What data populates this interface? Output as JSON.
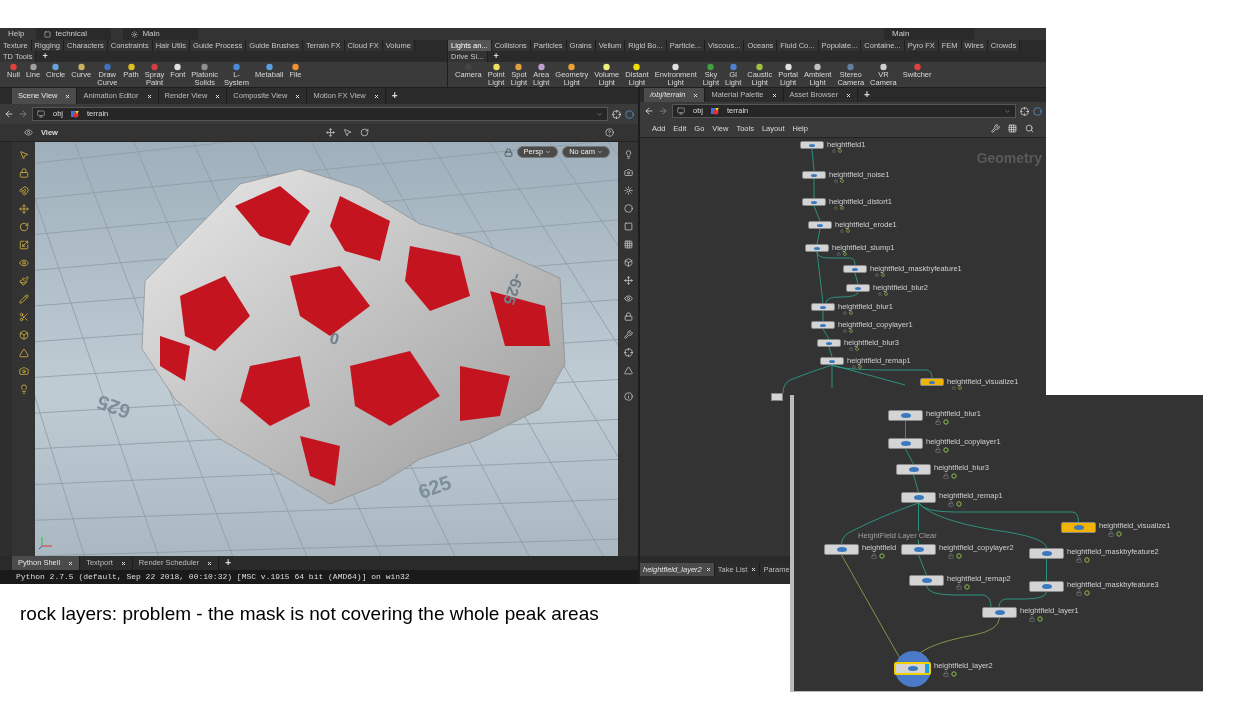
{
  "top_bar": {
    "menu": "Help",
    "desktops": [
      "technical",
      "Main"
    ],
    "right_desktop": "Main"
  },
  "shelf_left": {
    "tabs": [
      {
        "label": "Texture",
        "selected": false
      },
      {
        "label": "Rigging",
        "selected": false
      },
      {
        "label": "Characters",
        "selected": false
      },
      {
        "label": "Constraints",
        "selected": false
      },
      {
        "label": "Hair Utils",
        "selected": false
      },
      {
        "label": "Guide Process",
        "selected": false
      },
      {
        "label": "Guide Brushes",
        "selected": false
      },
      {
        "label": "Terrain FX",
        "selected": false
      },
      {
        "label": "Cloud FX",
        "selected": false
      },
      {
        "label": "Volume",
        "selected": false
      },
      {
        "label": "TD Tools",
        "selected": false
      }
    ],
    "add": "+",
    "tools": [
      "Null",
      "Line",
      "Circle",
      "Curve",
      "Draw Curve",
      "Path",
      "Spray Paint",
      "Font",
      "Platonic Solids",
      "L-System",
      "Metaball",
      "File"
    ]
  },
  "shelf_right": {
    "tabs": [
      {
        "label": "Lights an...",
        "selected": true
      },
      {
        "label": "Collisions",
        "selected": false
      },
      {
        "label": "Particles",
        "selected": false
      },
      {
        "label": "Grains",
        "selected": false
      },
      {
        "label": "Vellum",
        "selected": false
      },
      {
        "label": "Rigid Bo...",
        "selected": false
      },
      {
        "label": "Particle...",
        "selected": false
      },
      {
        "label": "Viscous...",
        "selected": false
      },
      {
        "label": "Oceans",
        "selected": false
      },
      {
        "label": "Fluid Co...",
        "selected": false
      },
      {
        "label": "Populate...",
        "selected": false
      },
      {
        "label": "Containe...",
        "selected": false
      },
      {
        "label": "Pyro FX",
        "selected": false
      },
      {
        "label": "FEM",
        "selected": false
      },
      {
        "label": "Wires",
        "selected": false
      },
      {
        "label": "Crowds",
        "selected": false
      },
      {
        "label": "Drive Si...",
        "selected": false
      }
    ],
    "add": "+",
    "tools": [
      "Camera",
      "Point Light",
      "Spot Light",
      "Area Light",
      "Geometry Light",
      "Volume Light",
      "Distant Light",
      "Environment Light",
      "Sky Light",
      "GI Light",
      "Caustic Light",
      "Portal Light",
      "Ambient Light",
      "Stereo Camera",
      "VR Camera",
      "Switcher"
    ]
  },
  "scene_pane": {
    "tabs": [
      {
        "label": "Scene View",
        "selected": true
      },
      {
        "label": "Animation Editor",
        "selected": false
      },
      {
        "label": "Render View",
        "selected": false
      },
      {
        "label": "Composite View",
        "selected": false
      },
      {
        "label": "Motion FX View",
        "selected": false
      }
    ],
    "add": "+",
    "path": [
      "obj",
      "terrain"
    ],
    "toolbar_title": "View",
    "camera_menus": [
      "Persp",
      "No cam"
    ],
    "grid_labels": [
      "625",
      "625",
      "-625",
      "0"
    ]
  },
  "network_pane": {
    "tabs": [
      {
        "label": "/obj/terrain",
        "selected": true
      },
      {
        "label": "Material Palette",
        "selected": false
      },
      {
        "label": "Asset Browser",
        "selected": false
      }
    ],
    "add": "+",
    "path": [
      "obj",
      "terrain"
    ],
    "menu": [
      "Add",
      "Edit",
      "Go",
      "View",
      "Tools",
      "Layout",
      "Help"
    ],
    "context_label": "Geometry",
    "nodes": [
      {
        "name": "heightfield1",
        "color": "#d4d4d4"
      },
      {
        "name": "heightfield_noise1",
        "color": "#d4d4d4"
      },
      {
        "name": "heightfield_distort1",
        "color": "#d4d4d4"
      },
      {
        "name": "heightfield_erode1",
        "color": "#d4d4d4"
      },
      {
        "name": "heightfield_slump1",
        "color": "#d4d4d4"
      },
      {
        "name": "heightfield_maskbyfeature1",
        "color": "#d4d4d4"
      },
      {
        "name": "heightfield_blur2",
        "color": "#d4d4d4"
      },
      {
        "name": "heightfield_blur1",
        "color": "#d4d4d4"
      },
      {
        "name": "heightfield_copylayer1",
        "color": "#d4d4d4"
      },
      {
        "name": "heightfield_blur3",
        "color": "#d4d4d4"
      },
      {
        "name": "heightfield_remap1",
        "color": "#d4d4d4"
      },
      {
        "name": "heightfield_visualize1",
        "color": "#f2b400"
      }
    ]
  },
  "zoomed_network": {
    "hint": "HeightField Layer Clear",
    "nodes": [
      {
        "name": "heightfield_blur1",
        "color": "#d4d4d4",
        "selected": false,
        "display": false
      },
      {
        "name": "heightfield_copylayer1",
        "color": "#d4d4d4",
        "selected": false,
        "display": false
      },
      {
        "name": "heightfield_blur3",
        "color": "#d4d4d4",
        "selected": false,
        "display": false
      },
      {
        "name": "heightfield_remap1",
        "color": "#d4d4d4",
        "selected": false,
        "display": false
      },
      {
        "name": "heightfield_visualize1",
        "color": "#f2b400",
        "selected": false,
        "display": false
      },
      {
        "name": "heightfield",
        "color": "#d4d4d4",
        "selected": false,
        "display": false
      },
      {
        "name": "heightfield_copylayer2",
        "color": "#d4d4d4",
        "selected": false,
        "display": false
      },
      {
        "name": "heightfield_maskbyfeature2",
        "color": "#d4d4d4",
        "selected": false,
        "display": false
      },
      {
        "name": "heightfield_remap2",
        "color": "#d4d4d4",
        "selected": false,
        "display": false
      },
      {
        "name": "heightfield_maskbyfeature3",
        "color": "#d4d4d4",
        "selected": false,
        "display": false
      },
      {
        "name": "heightfield_layer1",
        "color": "#d4d4d4",
        "selected": false,
        "display": false
      },
      {
        "name": "heightfield_layer2",
        "color": "#d4d4d4",
        "selected": true,
        "display": true
      }
    ]
  },
  "python_pane": {
    "tabs": [
      {
        "label": "Python Shell",
        "selected": true
      },
      {
        "label": "Textport",
        "selected": false
      },
      {
        "label": "Render Scheduler",
        "selected": false
      }
    ],
    "add": "+",
    "output": "Python 2.7.5 (default, Sep 22 2018, 00:10:32) [MSC v.1915 64 bit (AMD64)] on win32"
  },
  "parameter_pane": {
    "tabs": [
      {
        "label": "heightfield_layer2",
        "selected": true
      },
      {
        "label": "Take List",
        "selected": false
      },
      {
        "label": "Parame",
        "selected": false
      }
    ]
  },
  "caption": "rock layers: problem - the mask is not covering the whole peak areas"
}
